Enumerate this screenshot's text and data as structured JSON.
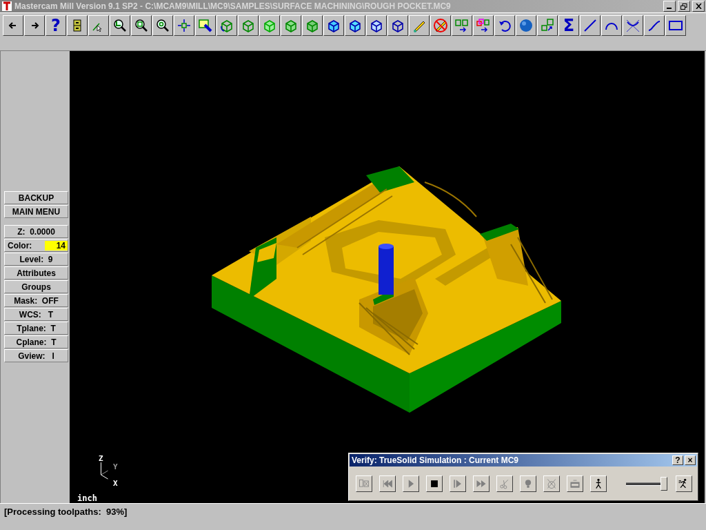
{
  "window": {
    "title": "Mastercam Mill Version 9.1 SP2 - C:\\MCAM9\\MILL\\MC9\\SAMPLES\\SURFACE MACHINING\\ROUGH POCKET.MC9"
  },
  "toolbar": {
    "help_label": "?",
    "sum_label": "Σ"
  },
  "menu": [
    {
      "kind": "button",
      "label": "BACKUP"
    },
    {
      "kind": "button",
      "label": "MAIN MENU"
    },
    {
      "kind": "gap"
    },
    {
      "kind": "button",
      "label": "Z:  0.0000"
    },
    {
      "kind": "color",
      "label": "Color:",
      "value": "14",
      "color": "#ffff00"
    },
    {
      "kind": "button",
      "label": "Level:  9"
    },
    {
      "kind": "button",
      "label": "Attributes"
    },
    {
      "kind": "button",
      "label": "Groups"
    },
    {
      "kind": "button",
      "label": "Mask:  OFF"
    },
    {
      "kind": "button",
      "label": "WCS:   T"
    },
    {
      "kind": "button",
      "label": "Tplane:  T"
    },
    {
      "kind": "button",
      "label": "Cplane:  T"
    },
    {
      "kind": "button",
      "label": "Gview:   I"
    }
  ],
  "viewport": {
    "axes": {
      "z": "Z",
      "y": "Y",
      "x": "X"
    },
    "units": "inch"
  },
  "verify": {
    "title": "Verify: TrueSolid Simulation : Current MC9",
    "help": "?",
    "close": "×",
    "buttons": [
      {
        "kind": "options",
        "disabled": true
      },
      {
        "kind": "rewind",
        "disabled": true
      },
      {
        "kind": "play",
        "disabled": true
      },
      {
        "kind": "stop",
        "disabled": false
      },
      {
        "kind": "step",
        "disabled": true
      },
      {
        "kind": "fast",
        "disabled": true
      },
      {
        "kind": "cut",
        "disabled": true
      },
      {
        "kind": "light",
        "disabled": true
      },
      {
        "kind": "tool",
        "disabled": true
      },
      {
        "kind": "save",
        "disabled": true
      },
      {
        "kind": "walk",
        "disabled": false
      }
    ],
    "speed": {
      "level": 0.95
    }
  },
  "status_bar": "[Processing toolpaths:  93%]"
}
